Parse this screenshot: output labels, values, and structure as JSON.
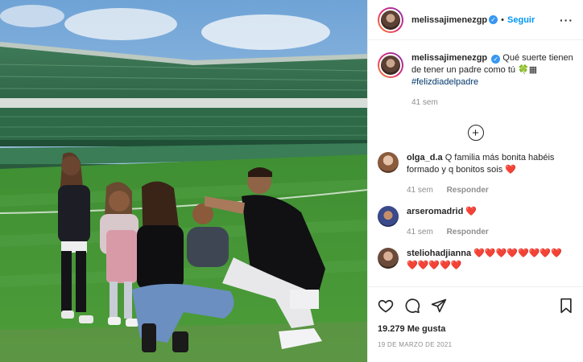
{
  "post": {
    "username": "melissajimenezgp",
    "follow_label": "Seguir",
    "separator": "•",
    "more_label": "···",
    "verified_glyph": "✓"
  },
  "caption": {
    "username": "melissajimenezgp",
    "text": "Qué suerte tienen de tener un padre como tú 🍀▦",
    "hashtag": "#felizdiadelpadre",
    "time": "41 sem"
  },
  "load_more_label": "+",
  "comments": [
    {
      "username": "olga_d.a",
      "text": "Q familia más bonita habéis formado y q bonitos sois ❤️",
      "time": "41 sem",
      "reply_label": "Responder"
    },
    {
      "username": "arseromadrid",
      "text": "❤️",
      "time": "41 sem",
      "reply_label": "Responder"
    },
    {
      "username": "steliohadjianna",
      "text": "❤️❤️❤️❤️❤️❤️❤️❤️ ❤️❤️❤️❤️❤️"
    }
  ],
  "footer": {
    "likes": "19.279 Me gusta",
    "date": "19 DE MARZO DE 2021"
  },
  "icons": {
    "like": "heart-icon",
    "comment": "comment-icon",
    "share": "share-icon",
    "save": "bookmark-icon"
  },
  "colors": {
    "link_blue": "#0095f6",
    "verified_blue": "#3897f0",
    "heart_red": "#e0245e",
    "hashtag": "#00376b",
    "muted": "#8e8e8e"
  }
}
